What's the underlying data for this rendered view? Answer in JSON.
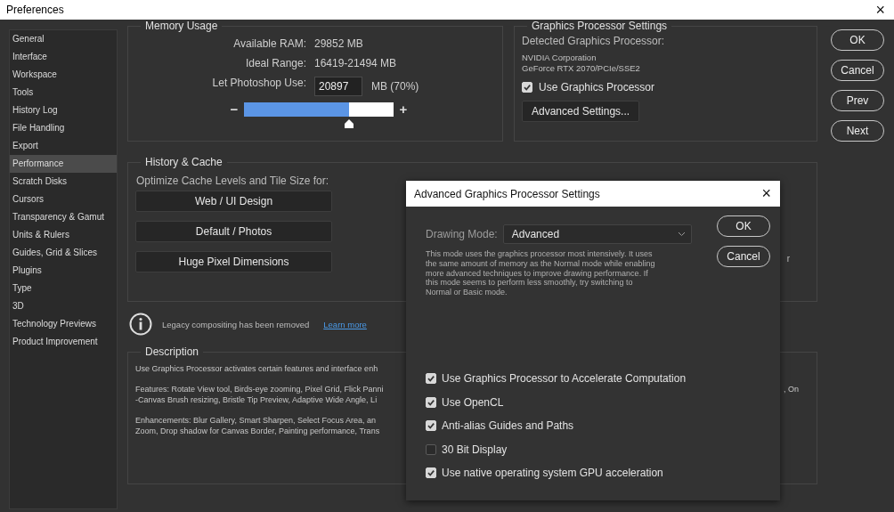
{
  "window": {
    "title": "Preferences",
    "close": "×"
  },
  "sidebar": {
    "items": [
      {
        "label": "General",
        "selected": false
      },
      {
        "label": "Interface",
        "selected": false
      },
      {
        "label": "Workspace",
        "selected": false
      },
      {
        "label": "Tools",
        "selected": false
      },
      {
        "label": "History Log",
        "selected": false
      },
      {
        "label": "File Handling",
        "selected": false
      },
      {
        "label": "Export",
        "selected": false
      },
      {
        "label": "Performance",
        "selected": true
      },
      {
        "label": "Scratch Disks",
        "selected": false
      },
      {
        "label": "Cursors",
        "selected": false
      },
      {
        "label": "Transparency & Gamut",
        "selected": false
      },
      {
        "label": "Units & Rulers",
        "selected": false
      },
      {
        "label": "Guides, Grid & Slices",
        "selected": false
      },
      {
        "label": "Plugins",
        "selected": false
      },
      {
        "label": "Type",
        "selected": false
      },
      {
        "label": "3D",
        "selected": false
      },
      {
        "label": "Technology Previews",
        "selected": false
      },
      {
        "label": "Product Improvement",
        "selected": false
      }
    ]
  },
  "memory_usage": {
    "title": "Memory Usage",
    "available_ram_label": "Available RAM:",
    "available_ram": "29852 MB",
    "ideal_range_label": "Ideal Range:",
    "ideal_range": "16419-21494 MB",
    "use_label": "Let Photoshop Use:",
    "use_value": "20897",
    "use_unit": "MB (70%)",
    "slider": {
      "minus": "−",
      "plus": "+",
      "level": 0.7
    }
  },
  "graphics_processor": {
    "title": "Graphics Processor Settings",
    "detected_label": "Detected Graphics Processor:",
    "vendor": "NVIDIA Corporation",
    "model": "GeForce RTX 2070/PCIe/SSE2",
    "use_gpu": {
      "label": "Use Graphics Processor",
      "checked": true
    },
    "advanced_button": "Advanced Settings..."
  },
  "history_cache": {
    "title": "History & Cache",
    "optimize_label": "Optimize Cache Levels and Tile Size for:",
    "buttons": [
      "Web / UI Design",
      "Default / Photos",
      "Huge Pixel Dimensions"
    ],
    "cut_text": "r"
  },
  "notice": {
    "text": "Legacy compositing has been removed",
    "link": "Learn more"
  },
  "description": {
    "title": "Description",
    "paragraphs": [
      [
        {
          "left": "Use Graphics Processor activates certain features and interface enh"
        }
      ],
      [
        {
          "left": "Features: Rotate View tool, Birds-eye zooming, Pixel Grid, Flick Panni",
          "right": ", On"
        },
        {
          "left": "-Canvas Brush resizing, Bristle Tip Preview, Adaptive Wide Angle, Li"
        }
      ],
      [
        {
          "left": "Enhancements: Blur Gallery, Smart Sharpen, Select Focus Area, an"
        },
        {
          "left": "Zoom, Drop shadow for Canvas Border, Painting performance, Trans"
        }
      ]
    ]
  },
  "buttons": [
    "OK",
    "Cancel",
    "Prev",
    "Next"
  ],
  "dialog": {
    "title": "Advanced Graphics Processor Settings",
    "close": "×",
    "drawing_mode_label": "Drawing Mode:",
    "drawing_mode": "Advanced",
    "explanation": [
      "This mode uses the graphics processor most intensively.  It uses",
      "the same amount of memory as the Normal mode while enabling",
      "more advanced techniques to improve drawing performance.  If",
      "this mode seems to perform less smoothly, try switching to",
      "Normal or Basic mode."
    ],
    "buttons": [
      "OK",
      "Cancel"
    ],
    "options": [
      {
        "label": "Use Graphics Processor to Accelerate Computation",
        "checked": true
      },
      {
        "label": "Use OpenCL",
        "checked": true
      },
      {
        "label": "Anti-alias Guides and Paths",
        "checked": true
      },
      {
        "label": "30 Bit Display",
        "checked": false
      },
      {
        "label": "Use native operating system GPU acceleration",
        "checked": true
      }
    ]
  }
}
